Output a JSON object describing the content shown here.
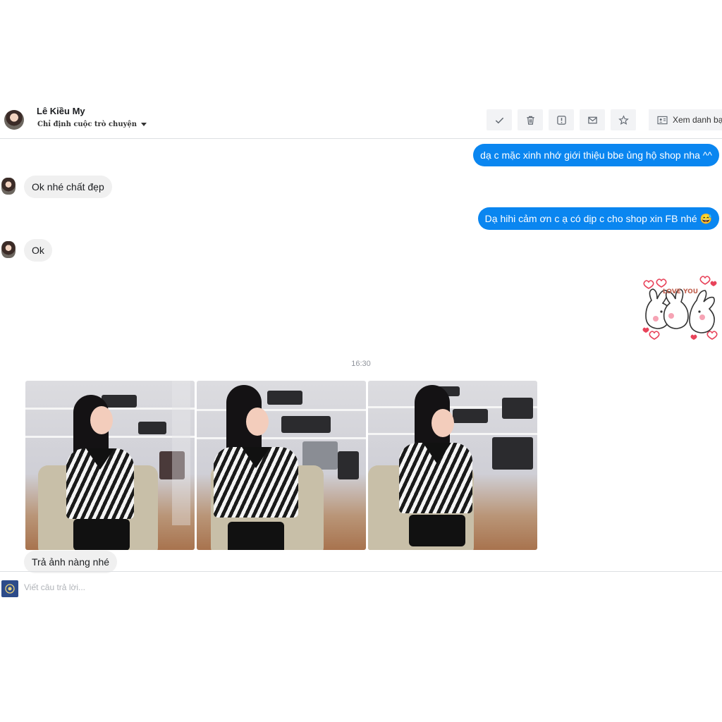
{
  "header": {
    "contact_name": "Lê Kiều My",
    "assign_label": "Chỉ định cuộc trò chuyện",
    "view_contact_label": "Xem danh bạ"
  },
  "messages": [
    {
      "direction": "out",
      "text": "dạ c mặc xinh nhớ giới thiệu bbe ủng hộ shop nha ^^"
    },
    {
      "direction": "in",
      "text": "Ok nhé chất đẹp"
    },
    {
      "direction": "out",
      "text": "Dạ hihi cảm ơn c ạ có dịp c cho shop xin FB nhé 😅"
    },
    {
      "direction": "in",
      "text": "Ok"
    },
    {
      "direction": "out",
      "type": "sticker",
      "text": "LOVE YOU"
    }
  ],
  "timestamp": "16:30",
  "photo_caption": "Trả ảnh nàng nhé",
  "reply": {
    "placeholder": "Viết câu trả lời..."
  },
  "colors": {
    "accent": "#0a86f0",
    "incoming_bubble": "#f0f0f0"
  }
}
